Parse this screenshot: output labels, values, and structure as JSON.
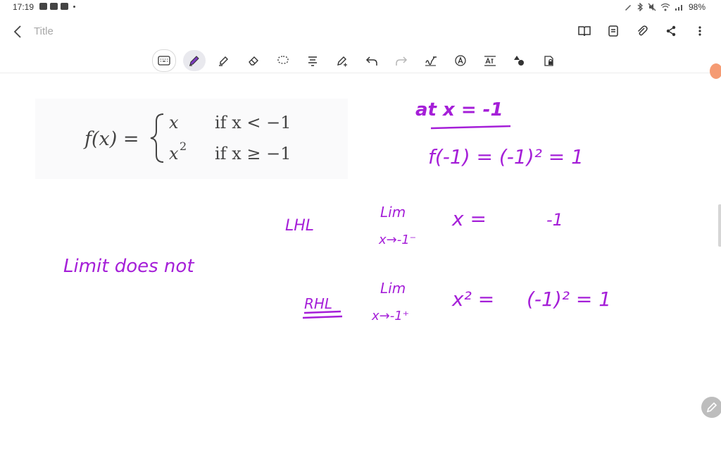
{
  "status_bar": {
    "time": "17:19",
    "battery": "98%",
    "left_icons": [
      "gallery-icon",
      "youtube-icon",
      "video-icon"
    ],
    "right_icons": [
      "pen-icon",
      "bluetooth-icon",
      "mute-icon",
      "wifi-icon",
      "signal-icon"
    ]
  },
  "header": {
    "title": "Title",
    "actions": [
      "book-icon",
      "page-icon",
      "attach-icon",
      "share-icon",
      "more-vert-icon"
    ]
  },
  "toolbar": {
    "tools": [
      "keyboard",
      "pen",
      "highlighter",
      "eraser",
      "lasso",
      "text-align",
      "pen-settings",
      "undo",
      "redo",
      "handwriting-to-text",
      "text-style",
      "text-format",
      "shapes",
      "lock"
    ],
    "active_tool": "pen"
  },
  "colors": {
    "ink": "#a51fd8",
    "accent": "#f59b73",
    "toolbar_active": "#e9e9ee"
  },
  "formula": {
    "fx": "f(x) =",
    "case1_expr": "x",
    "case1_cond": "if x < −1",
    "case2_expr": "x",
    "case2_exp": "2",
    "case2_cond": "if x ≥ −1"
  },
  "handwriting": {
    "at_x": "at x = -1",
    "f_value": "f(-1) = (-1)² = 1",
    "lhl_label": "LHL",
    "lhl_lim": "Lim",
    "lhl_sub": "x→-1⁻",
    "lhl_expr": "x =",
    "lhl_val": "-1",
    "rhl_label": "RHL",
    "rhl_lim": "Lim",
    "rhl_sub": "x→-1⁺",
    "rhl_expr": "x² =",
    "rhl_val": "(-1)² = 1",
    "note": "Limit does not"
  }
}
